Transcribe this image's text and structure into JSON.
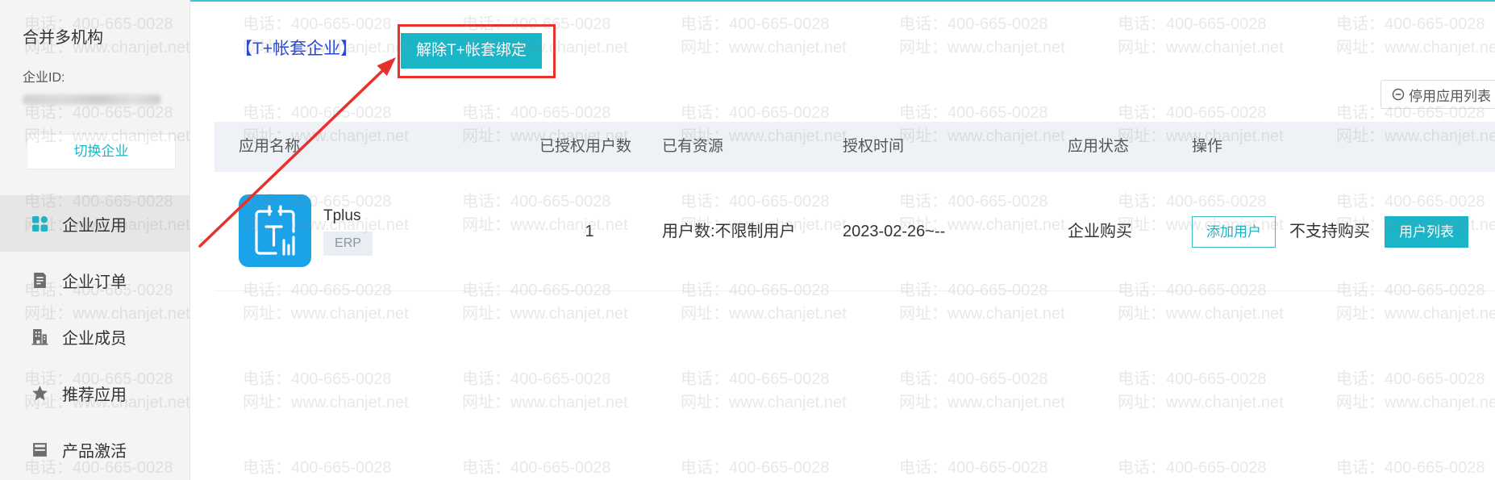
{
  "sidebar": {
    "org_title": "合并多机构",
    "org_id_label": "企业ID:",
    "switch_button": "切换企业",
    "menu": [
      {
        "label": "企业应用",
        "icon": "grid-icon",
        "active": true
      },
      {
        "label": "企业订单",
        "icon": "order-icon",
        "active": false
      },
      {
        "label": "企业成员",
        "icon": "building-icon",
        "active": false
      },
      {
        "label": "推荐应用",
        "icon": "star-icon",
        "active": false
      },
      {
        "label": "产品激活",
        "icon": "activation-icon",
        "active": false
      }
    ]
  },
  "main": {
    "company_tag": "【T+帐套企业】",
    "unbind_button": "解除T+帐套绑定",
    "disabled_apps_button": {
      "label": "停用应用列表",
      "icon": "circle-minus-icon"
    },
    "table": {
      "headers": [
        "应用名称",
        "已授权用户数",
        "已有资源",
        "授权时间",
        "应用状态",
        "操作"
      ],
      "rows": [
        {
          "app_icon": "tplus-app-icon",
          "app_name": "Tplus",
          "app_tag": "ERP",
          "licensed_users": "1",
          "resources": "用户数:不限制用户",
          "auth_time": "2023-02-26~--",
          "status": "企业购买",
          "actions": {
            "add_user": "添加用户",
            "purchase": "不支持购买",
            "user_list": "用户列表"
          }
        }
      ]
    }
  },
  "watermark": {
    "phone": "电话：400-665-0028",
    "url": "网址：www.chanjet.net"
  },
  "colors": {
    "accent": "#1bb5c8",
    "highlight": "#e8312c",
    "tag_text": "#2548d8",
    "app_icon_bg": "#1ba3ea"
  }
}
